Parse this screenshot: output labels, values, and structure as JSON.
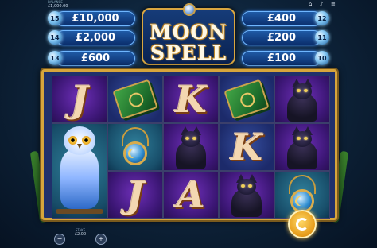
{
  "balance": {
    "label": "BALANCE",
    "value": "£1,000.00"
  },
  "icons": {
    "home": "home-icon",
    "speaker": "speaker-icon",
    "menu": "menu-icon"
  },
  "jackpots": [
    {
      "value": "£10,000",
      "number": "15"
    },
    {
      "value": "£2,000",
      "number": "14"
    },
    {
      "value": "£600",
      "number": "13"
    },
    {
      "value": "£400",
      "number": "12"
    },
    {
      "value": "£200",
      "number": "11"
    },
    {
      "value": "£100",
      "number": "10"
    }
  ],
  "logo": {
    "line1": "MOON",
    "line2": "SPELL"
  },
  "reels": [
    [
      "J",
      "book",
      "K",
      "book",
      "cat"
    ],
    [
      "amulet",
      "cat",
      "owl",
      "K",
      "cat"
    ],
    [
      "J",
      "A",
      "cat",
      "cat",
      "amulet"
    ]
  ],
  "stake": {
    "label": "STAKE",
    "value": "£2.00"
  },
  "colors": {
    "gold": "#d6a53c",
    "spin": "#e59a18",
    "jackpot": "#1f5aa6"
  }
}
